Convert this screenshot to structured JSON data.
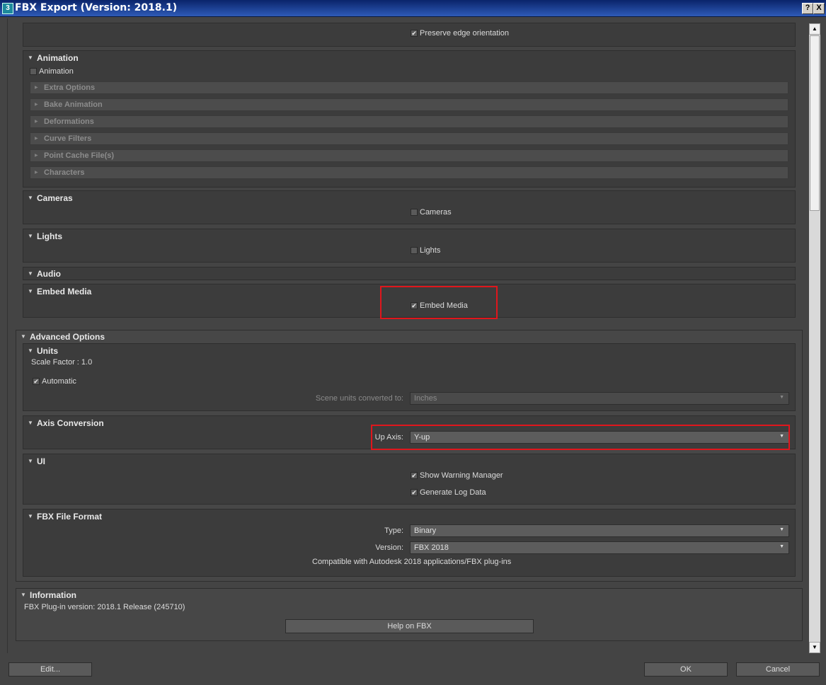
{
  "window": {
    "title": "FBX Export (Version: 2018.1)",
    "icon_glyph": "3",
    "help_glyph": "?",
    "close_glyph": "X"
  },
  "geometry": {
    "preserve_edge_orientation": "Preserve edge orientation"
  },
  "animation": {
    "header": "Animation",
    "checkbox": "Animation",
    "subsections": [
      "Extra Options",
      "Bake Animation",
      "Deformations",
      "Curve Filters",
      "Point Cache File(s)",
      "Characters"
    ]
  },
  "cameras": {
    "header": "Cameras",
    "checkbox": "Cameras"
  },
  "lights": {
    "header": "Lights",
    "checkbox": "Lights"
  },
  "audio": {
    "header": "Audio"
  },
  "embed_media": {
    "header": "Embed Media",
    "checkbox": "Embed Media"
  },
  "advanced": {
    "header": "Advanced Options",
    "units": {
      "header": "Units",
      "scale_factor": "Scale Factor : 1.0",
      "automatic": "Automatic",
      "scene_units_label": "Scene units converted to:",
      "scene_units_value": "Inches"
    },
    "axis": {
      "header": "Axis Conversion",
      "up_axis_label": "Up Axis:",
      "up_axis_value": "Y-up"
    },
    "ui": {
      "header": "UI",
      "show_warning": "Show Warning Manager",
      "generate_log": "Generate Log Data"
    },
    "fbx_format": {
      "header": "FBX File Format",
      "type_label": "Type:",
      "type_value": "Binary",
      "version_label": "Version:",
      "version_value": "FBX 2018",
      "compat": "Compatible with Autodesk 2018 applications/FBX plug-ins"
    }
  },
  "information": {
    "header": "Information",
    "plugin_version": "FBX Plug-in version: 2018.1 Release (245710)",
    "help_button": "Help on FBX"
  },
  "footer": {
    "edit": "Edit...",
    "ok": "OK",
    "cancel": "Cancel"
  },
  "colors": {
    "highlight": "#e0161c",
    "panel": "#3c3c3c",
    "background": "#444444"
  }
}
